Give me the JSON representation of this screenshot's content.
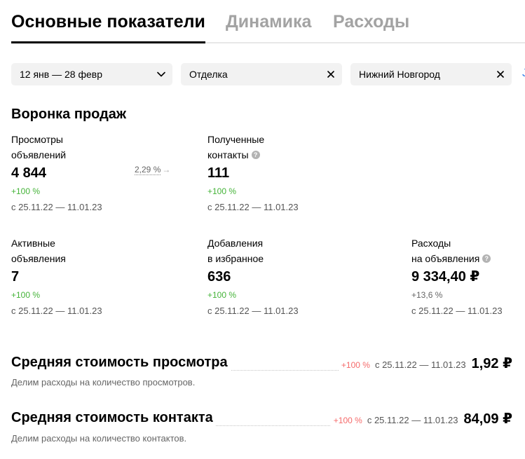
{
  "tabs": [
    {
      "label": "Основные показатели",
      "active": true
    },
    {
      "label": "Динамика",
      "active": false
    },
    {
      "label": "Расходы",
      "active": false
    }
  ],
  "filters": {
    "date": {
      "value": "12 янв — 28 февр",
      "icon": "chevron-down-icon"
    },
    "category": {
      "value": "Отделка",
      "icon": "close-icon"
    },
    "city": {
      "value": "Нижний Новгород",
      "icon": "close-icon"
    }
  },
  "funnel": {
    "title": "Воронка продаж",
    "conversion": "2,29 %",
    "metrics": {
      "views": {
        "label1": "Просмотры",
        "label2": "объявлений",
        "value": "4 844",
        "change": "+100 %",
        "period": "с 25.11.22 — 11.01.23"
      },
      "contacts": {
        "label1": "Полученные",
        "label2": "контакты",
        "value": "111",
        "change": "+100 %",
        "period": "с 25.11.22 — 11.01.23"
      },
      "active": {
        "label1": "Активные",
        "label2": "объявления",
        "value": "7",
        "change": "+100 %",
        "period": "с 25.11.22 — 11.01.23"
      },
      "favorites": {
        "label1": "Добавления",
        "label2": "в избранное",
        "value": "636",
        "change": "+100 %",
        "period": "с 25.11.22 — 11.01.23"
      },
      "costs": {
        "label1": "Расходы",
        "label2": "на объявления",
        "value": "9 334,40 ₽",
        "change": "+13,6 %",
        "period": "с 25.11.22 — 11.01.23"
      }
    }
  },
  "avg_view": {
    "title": "Средняя стоимость просмотра",
    "change": "+100 %",
    "period": "с 25.11.22 — 11.01.23",
    "value": "1,92 ₽",
    "description": "Делим расходы на количество просмотров."
  },
  "avg_contact": {
    "title": "Средняя стоимость контакта",
    "change": "+100 %",
    "period": "с 25.11.22 — 11.01.23",
    "value": "84,09 ₽",
    "description": "Делим расходы на количество контактов."
  },
  "colors": {
    "positive": "#44b338",
    "negative": "#f56a6a",
    "accent": "#2f7ee8"
  }
}
